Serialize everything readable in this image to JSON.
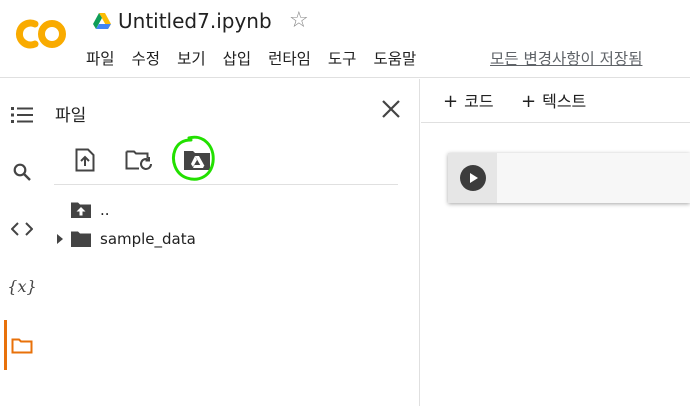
{
  "header": {
    "logo_text": "CO",
    "notebook_title": "Untitled7.ipynb",
    "menu": [
      "파일",
      "수정",
      "보기",
      "삽입",
      "런타임",
      "도구",
      "도움말"
    ],
    "save_status": "모든 변경사항이 저장됨"
  },
  "rail": {
    "items": [
      "toc-icon",
      "search-icon",
      "code-snippets-icon",
      "variables-icon",
      "files-icon"
    ],
    "variables_label": "{x}",
    "active": "files-icon",
    "accent_color": "#e8710a"
  },
  "files_panel": {
    "title": "파일",
    "tree": [
      {
        "label": "..",
        "icon": "folder-up-icon",
        "expandable": false
      },
      {
        "label": "sample_data",
        "icon": "folder-icon",
        "expandable": true
      }
    ]
  },
  "main": {
    "toolbar": {
      "add_code": "코드",
      "add_text": "텍스트"
    }
  },
  "colors": {
    "logo_orange": "#f9ab00",
    "annotation_green": "#22e000",
    "text": "#212121"
  }
}
